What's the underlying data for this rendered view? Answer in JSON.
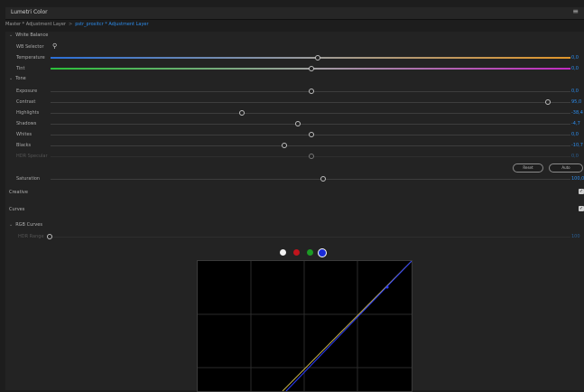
{
  "panel": {
    "title": "Lumetri Color",
    "menu_icon": "hamburger-menu-icon"
  },
  "clip": {
    "master": "Master * Adjustment Layer",
    "active": "pstr_proxitcr * Adjustment Layer",
    "separator": ">"
  },
  "white_balance": {
    "title": "White Balance",
    "wb_selector_label": "WB Selector",
    "temperature": {
      "label": "Temperature",
      "value": "0,0",
      "level": 0.5
    },
    "tint": {
      "label": "Tint",
      "value": "0,0",
      "level": 0.5
    }
  },
  "tone": {
    "title": "Tone",
    "sliders": [
      {
        "label": "Exposure",
        "value": "0,0",
        "level": 0.5
      },
      {
        "label": "Contrast",
        "value": "95,0",
        "level": 0.975
      },
      {
        "label": "Highlights",
        "value": "-38,4",
        "level": 0.36
      },
      {
        "label": "Shadows",
        "value": "-4,7",
        "level": 0.475
      },
      {
        "label": "Whites",
        "value": "0,0",
        "level": 0.5
      },
      {
        "label": "Blacks",
        "value": "-10,7",
        "level": 0.445
      },
      {
        "label": "HDR Specular",
        "value": "0,0",
        "level": 0.5,
        "disabled": true
      }
    ],
    "reset_label": "Reset",
    "auto_label": "Auto"
  },
  "saturation": {
    "label": "Saturation",
    "value": "100,0",
    "level": 0.5
  },
  "creative": {
    "label": "Creative",
    "checked": true
  },
  "curves": {
    "label": "Curves",
    "checked": true,
    "rgb_curves_title": "RGB Curves",
    "hdr_range": {
      "label": "HDR Range",
      "value": "100"
    },
    "channels": [
      "white",
      "red",
      "green",
      "blue"
    ],
    "selected_channel": "blue"
  }
}
